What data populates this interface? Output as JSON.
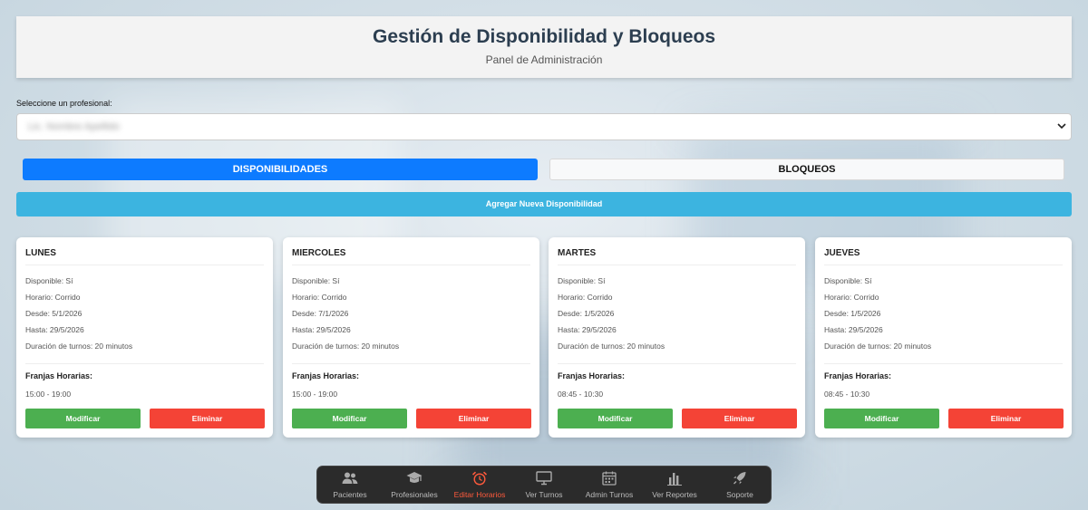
{
  "header": {
    "title": "Gestión de Disponibilidad y Bloqueos",
    "subtitle": "Panel de Administración"
  },
  "professional_select": {
    "label": "Seleccione un profesional:",
    "value": "Lic. Nombre Apellido"
  },
  "tabs": [
    {
      "label": "DISPONIBILIDADES",
      "active": true
    },
    {
      "label": "BLOQUEOS",
      "active": false
    }
  ],
  "add_button": "Agregar Nueva Disponibilidad",
  "cards": [
    {
      "day": "LUNES",
      "available": "Disponible: Sí",
      "schedule": "Horario: Corrido",
      "from": "Desde: 5/1/2026",
      "to": "Hasta: 29/5/2026",
      "duration": "Duración de turnos: 20 minutos",
      "slots_title": "Franjas Horarias:",
      "slot": "15:00 - 19:00",
      "modify": "Modificar",
      "delete": "Eliminar"
    },
    {
      "day": "MIERCOLES",
      "available": "Disponible: Sí",
      "schedule": "Horario: Corrido",
      "from": "Desde: 7/1/2026",
      "to": "Hasta: 29/5/2026",
      "duration": "Duración de turnos: 20 minutos",
      "slots_title": "Franjas Horarias:",
      "slot": "15:00 - 19:00",
      "modify": "Modificar",
      "delete": "Eliminar"
    },
    {
      "day": "MARTES",
      "available": "Disponible: Sí",
      "schedule": "Horario: Corrido",
      "from": "Desde: 1/5/2026",
      "to": "Hasta: 29/5/2026",
      "duration": "Duración de turnos: 20 minutos",
      "slots_title": "Franjas Horarias:",
      "slot": "08:45 - 10:30",
      "modify": "Modificar",
      "delete": "Eliminar"
    },
    {
      "day": "JUEVES",
      "available": "Disponible: Sí",
      "schedule": "Horario: Corrido",
      "from": "Desde: 1/5/2026",
      "to": "Hasta: 29/5/2026",
      "duration": "Duración de turnos: 20 minutos",
      "slots_title": "Franjas Horarias:",
      "slot": "08:45 - 10:30",
      "modify": "Modificar",
      "delete": "Eliminar"
    }
  ],
  "nav": [
    {
      "label": "Pacientes",
      "icon": "users-icon"
    },
    {
      "label": "Profesionales",
      "icon": "graduation-cap-icon"
    },
    {
      "label": "Editar Horarios",
      "icon": "alarm-clock-icon",
      "active": true
    },
    {
      "label": "Ver Turnos",
      "icon": "monitor-icon"
    },
    {
      "label": "Admin Turnos",
      "icon": "calendar-icon"
    },
    {
      "label": "Ver Reportes",
      "icon": "bar-chart-icon"
    },
    {
      "label": "Soporte",
      "icon": "rocket-icon"
    }
  ],
  "colors": {
    "primary": "#0d7bff",
    "info": "#3cb4e0",
    "success": "#4caf50",
    "danger": "#f44336",
    "nav_active": "#ff5a3c"
  }
}
